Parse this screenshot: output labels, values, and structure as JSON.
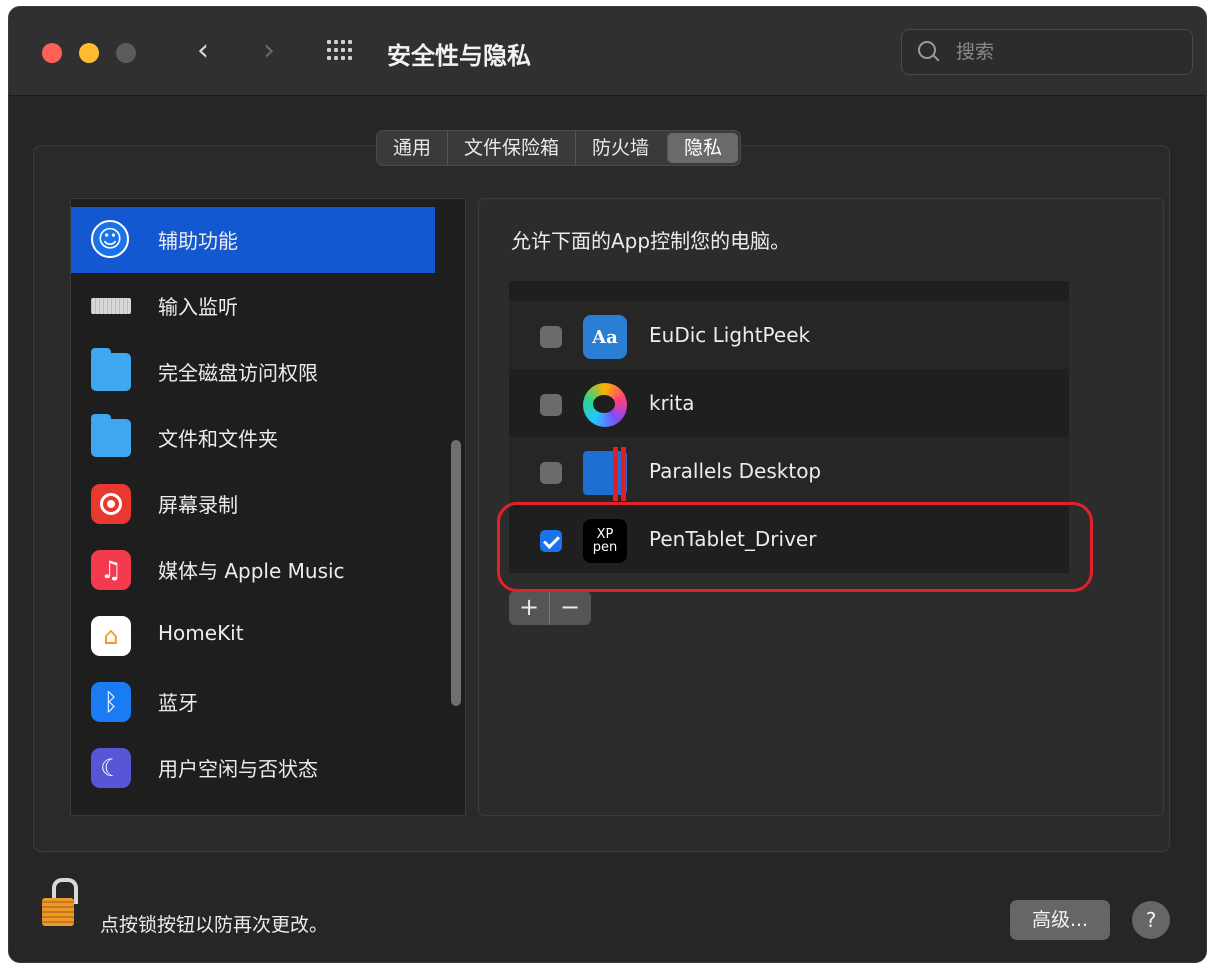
{
  "window": {
    "title": "安全性与隐私"
  },
  "search": {
    "placeholder": "搜索"
  },
  "tabs": [
    {
      "label": "通用",
      "active": false
    },
    {
      "label": "文件保险箱",
      "active": false
    },
    {
      "label": "防火墙",
      "active": false
    },
    {
      "label": "隐私",
      "active": true
    }
  ],
  "sidebar": {
    "items": [
      {
        "label": "辅助功能",
        "icon": "accessibility-icon",
        "selected": true
      },
      {
        "label": "输入监听",
        "icon": "keyboard-icon",
        "selected": false
      },
      {
        "label": "完全磁盘访问权限",
        "icon": "folder-icon",
        "selected": false
      },
      {
        "label": "文件和文件夹",
        "icon": "folder-icon",
        "selected": false
      },
      {
        "label": "屏幕录制",
        "icon": "screen-record-icon",
        "selected": false
      },
      {
        "label": "媒体与 Apple Music",
        "icon": "music-icon",
        "selected": false
      },
      {
        "label": "HomeKit",
        "icon": "home-icon",
        "selected": false
      },
      {
        "label": "蓝牙",
        "icon": "bluetooth-icon",
        "selected": false
      },
      {
        "label": "用户空闲与否状态",
        "icon": "moon-icon",
        "selected": false
      }
    ]
  },
  "panel": {
    "description": "允许下面的App控制您的电脑。",
    "apps": [
      {
        "name": "EuDic LightPeek",
        "checked": false,
        "icon": "eudic-icon"
      },
      {
        "name": "krita",
        "checked": false,
        "icon": "krita-icon"
      },
      {
        "name": "Parallels Desktop",
        "checked": false,
        "icon": "parallels-icon"
      },
      {
        "name": "PenTablet_Driver",
        "checked": true,
        "icon": "xp-pen-icon"
      }
    ],
    "add_label": "+",
    "remove_label": "−"
  },
  "icons": {
    "eudic_glyph": "Aa",
    "xp_top": "XP",
    "xp_bottom": "pen",
    "music_glyph": "♫",
    "home_glyph": "⌂",
    "bluetooth_glyph": "ᛒ",
    "moon_glyph": "☾",
    "access_glyph": "☺"
  },
  "footer": {
    "lock_text": "点按锁按钮以防再次更改。",
    "advanced_label": "高级...",
    "help_label": "?"
  },
  "colors": {
    "accent": "#1458d1",
    "highlight_border": "#e2212a"
  }
}
